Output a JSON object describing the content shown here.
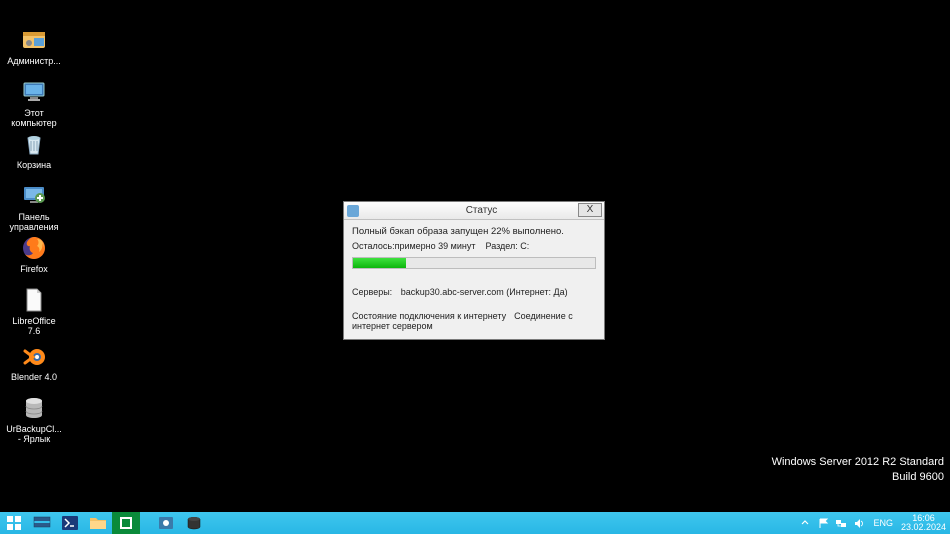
{
  "desktop_icons": [
    {
      "label": "Администр..."
    },
    {
      "label": "Этот\nкомпьютер"
    },
    {
      "label": "Корзина"
    },
    {
      "label": "Панель\nуправления"
    },
    {
      "label": "Firefox"
    },
    {
      "label": "LibreOffice\n7.6"
    },
    {
      "label": "Blender 4.0"
    },
    {
      "label": "UrBackupCl...\n- Ярлык"
    }
  ],
  "watermark": {
    "line1": "Windows Server 2012 R2 Standard",
    "line2": "Build 9600"
  },
  "dialog": {
    "title": "Статус",
    "close": "X",
    "line1": "Полный бэкап образа запущен 22% выполнено.",
    "remaining": "Осталось:примерно 39 минут",
    "partition": "Раздел: C:",
    "progress_percent": 22,
    "servers_label": "Серверы:",
    "servers_value": "backup30.abc-server.com (Интернет: Да)",
    "link1": "Состояние подключения к интернету",
    "link2": "Соединение с интернет сервером"
  },
  "taskbar": {
    "lang": "ENG",
    "time": "16:06",
    "date": "23.02.2024"
  }
}
